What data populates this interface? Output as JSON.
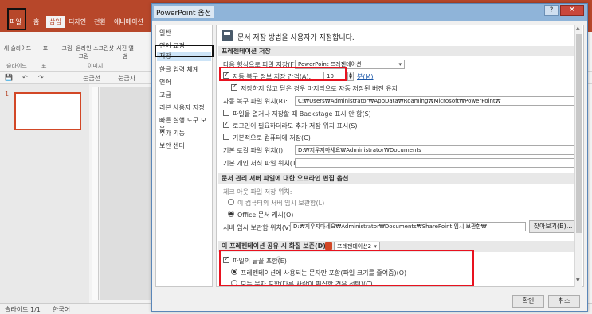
{
  "ppt": {
    "tabs": [
      "파일",
      "홈",
      "삽입",
      "디자인",
      "전환",
      "애니메이션"
    ],
    "active_tab": "삽입",
    "ribbon_buttons": [
      "새 슬라이드",
      "표",
      "그림",
      "온라인 그림",
      "스크린샷",
      "사진 앨범"
    ],
    "ribbon_groups": [
      "슬라이드",
      "표",
      "이미지"
    ],
    "qat_items": [
      "눈금선",
      "눈금자"
    ],
    "slide_number": "1",
    "status": {
      "slide": "슬라이드 1/1",
      "language": "한국어"
    },
    "accent": "#b7472a"
  },
  "dialog": {
    "title": "PowerPoint 옵션",
    "help": "?",
    "close": "✕",
    "nav": [
      "일반",
      "언어 교정",
      "저장",
      "한글 입력 체계",
      "언어",
      "고급",
      "리본 사용자 지정",
      "빠른 실행 도구 모음",
      "추가 기능",
      "보안 센터"
    ],
    "nav_selected_index": 2,
    "header": "문서 저장 방법을 사용자가 지정합니다.",
    "sections": {
      "save": "프레젠테이션 저장",
      "offline": "문서 관리 서버 파일에 대한 오프라인 편집 옵션",
      "fidelity": "이 프레젠테이션 공유 시 화질 보존(D):"
    },
    "save_format_label": "다음 형식으로 파일 저장(F):",
    "save_format_value": "PowerPoint 프레젠테이션",
    "autorecover_label": "자동 복구 정보 저장 간격(A):",
    "autorecover_value": "10",
    "autorecover_unit": "분(M)",
    "keep_last_label": "저장하지 않고 닫은 경우 마지막으로 자동 저장된 버전 유지",
    "autorecover_loc_label": "자동 복구 파일 위치(R):",
    "autorecover_loc_value": "C:₩Users₩Administrator₩AppData₩Roaming₩Microsoft₩PowerPoint₩",
    "backstage_label": "파일을 열거나 저장할 때 Backstage 표시 안 함(S)",
    "extra_locations_label": "로그인이 필요하더라도 추가 저장 위치 표시(S)",
    "default_computer_label": "기본적으로 컴퓨터에 저장(C)",
    "default_local_label": "기본 로컬 파일 위치(I):",
    "default_local_value": "D:₩지우지마세요₩Administrator₩Documents",
    "personal_template_label": "기본 개인 서식 파일 위치(T):",
    "personal_template_value": "",
    "checkout_label": "체크 아웃 파일 저장 위치:",
    "server_drafts_label": "이 컴퓨터의 서버 임시 보관함(L)",
    "office_cache_label": "Office 문서 캐시(O)",
    "server_drafts_loc_label": "서버 임시 보관함 위치(V):",
    "server_drafts_loc_value": "D:₩지우지마세요₩Administrator₩Documents₩SharePoint 임시 보관함₩",
    "browse_button": "찾아보기(B)...",
    "fidelity_value": "프레젠테이션2",
    "embed_fonts_label": "파일의 글꼴 포함(E)",
    "embed_used_label": "프레젠테이션에 사용되는 문자만 포함(파일 크기를 줄여줌)(O)",
    "embed_all_label": "모든 문자 포함(다른 사람이 편집할 경우 선택)(C)",
    "ok_button": "확인",
    "cancel_button": "취소"
  }
}
